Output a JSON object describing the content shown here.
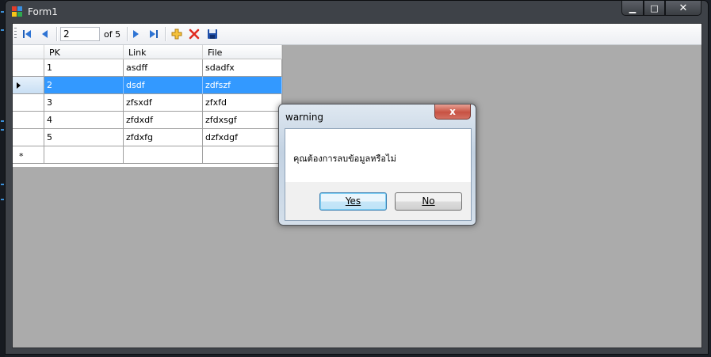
{
  "window": {
    "title": "Form1",
    "minimize_glyph": "▁",
    "maximize_glyph": "□",
    "close_glyph": "✕"
  },
  "navigator": {
    "position_value": "2",
    "count_label": "of 5",
    "icons": [
      "move-first-icon",
      "move-previous-icon",
      "move-next-icon",
      "move-last-icon",
      "add-new-icon",
      "delete-icon",
      "save-icon"
    ]
  },
  "grid": {
    "columns": [
      "PK",
      "Link",
      "File"
    ],
    "rows": [
      [
        "1",
        "asdff",
        "sdadfx"
      ],
      [
        "2",
        "dsdf",
        "zdfszf"
      ],
      [
        "3",
        "zfsxdf",
        "zfxfd"
      ],
      [
        "4",
        "zfdxdf",
        "zfdxsgf"
      ],
      [
        "5",
        "zfdxfg",
        "dzfxdgf"
      ]
    ],
    "selected_row": 1,
    "new_row_marker": "*",
    "colors": {
      "selection": "#3399ff"
    }
  },
  "dialog": {
    "title": "warning",
    "message": "คุณต้องการลบข้อมูลหรือไม่",
    "close_glyph": "x",
    "yes_label": "Yes",
    "no_label": "No"
  }
}
